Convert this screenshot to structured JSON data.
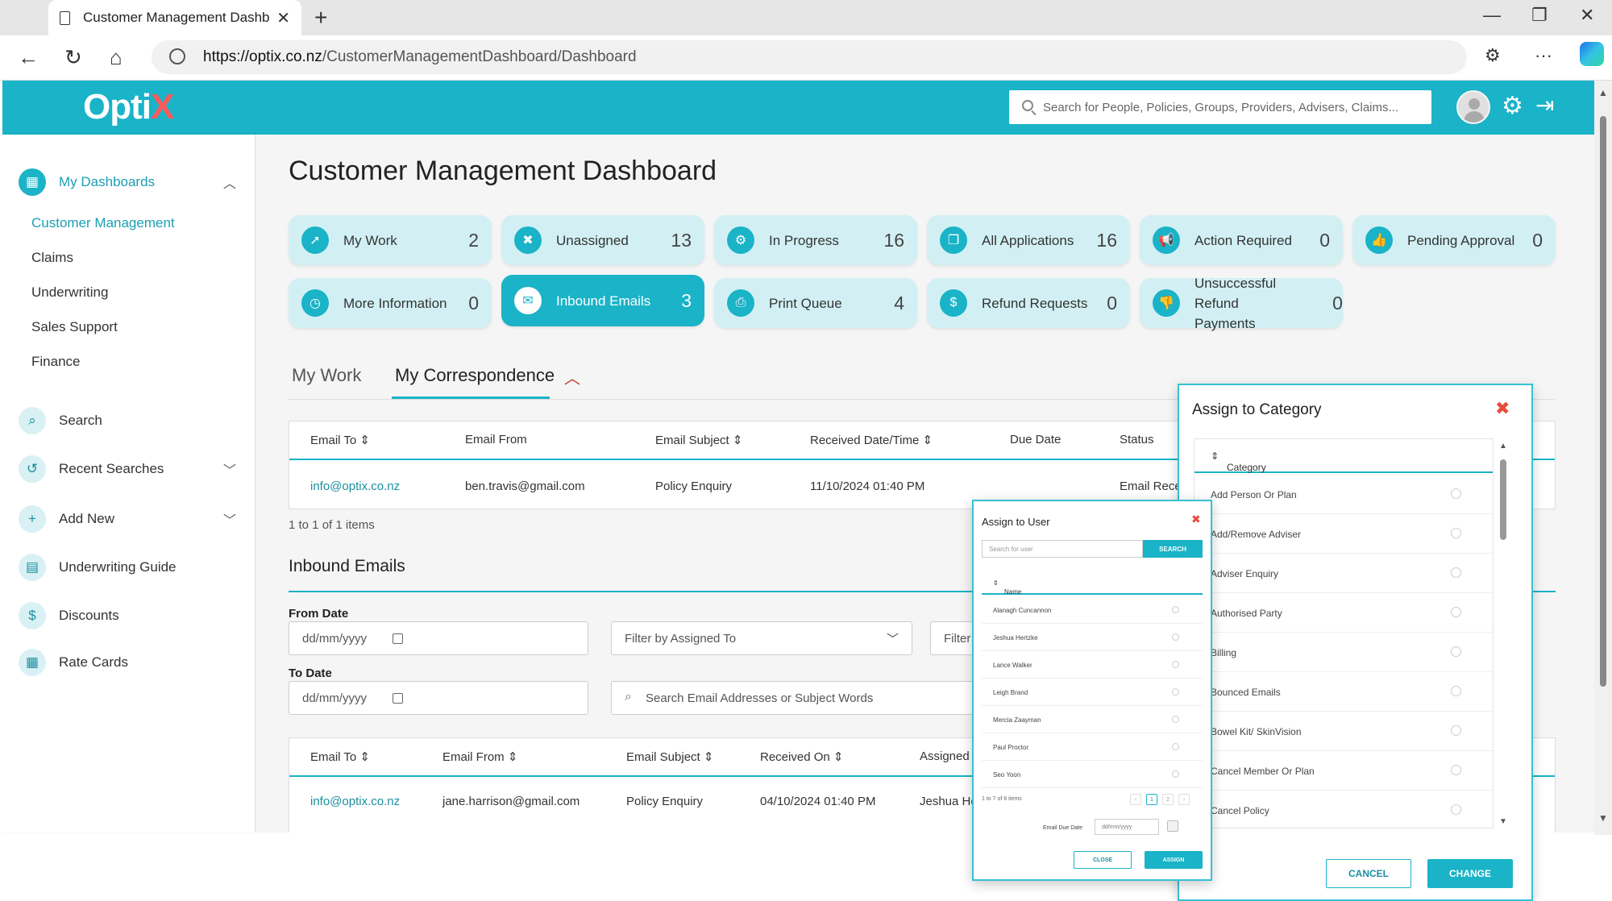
{
  "browser": {
    "tab_title": "Customer Management Dashboar",
    "url_host": "https://optix.co.nz",
    "url_path": "/CustomerManagementDashboard/Dashboard"
  },
  "header": {
    "logo_main": "Opti",
    "logo_accent": "X",
    "search_placeholder": "Search for People, Policies, Groups, Providers, Advisers, Claims..."
  },
  "sidebar": {
    "my_dashboards": "My Dashboards",
    "sub_items": [
      "Customer Management",
      "Claims",
      "Underwriting",
      "Sales Support",
      "Finance"
    ],
    "search": "Search",
    "recent_searches": "Recent Searches",
    "add_new": "Add New",
    "underwriting_guide": "Underwriting Guide",
    "discounts": "Discounts",
    "rate_cards": "Rate Cards"
  },
  "main": {
    "title": "Customer Management Dashboard",
    "cards": [
      {
        "label": "My Work",
        "count": "2"
      },
      {
        "label": "Unassigned",
        "count": "13"
      },
      {
        "label": "In Progress",
        "count": "16"
      },
      {
        "label": "All Applications",
        "count": "16"
      },
      {
        "label": "Action Required",
        "count": "0"
      },
      {
        "label": "Pending Approval",
        "count": "0"
      },
      {
        "label": "More Information",
        "count": "0"
      },
      {
        "label": "Inbound Emails",
        "count": "3"
      },
      {
        "label": "Print Queue",
        "count": "4"
      },
      {
        "label": "Refund Requests",
        "count": "0"
      },
      {
        "label": "Unsuccessful Refund Payments",
        "count": "0"
      }
    ],
    "tabs": [
      "My Work",
      "My Correspondence"
    ],
    "correspondence_table": {
      "headers": [
        "Email To",
        "Email From",
        "Email Subject",
        "Received Date/Time",
        "Due Date",
        "Status"
      ],
      "row": [
        "info@optix.co.nz",
        "ben.travis@gmail.com",
        "Policy Enquiry",
        "11/10/2024 01:40 PM",
        "",
        "Email Rece"
      ]
    },
    "items_count": "1 to 1 of 1 items",
    "inbound_title": "Inbound Emails",
    "from_date_label": "From Date",
    "to_date_label": "To Date",
    "date_placeholder": "dd/mm/yyyy",
    "filter_assigned": "Filter by Assigned To",
    "filter_other": "Filter",
    "search_emails_placeholder": "Search Email Addresses or Subject Words",
    "inbound_table": {
      "headers": [
        "Email To",
        "Email From",
        "Email Subject",
        "Received On",
        "Assigned"
      ],
      "row": [
        "info@optix.co.nz",
        "jane.harrison@gmail.com",
        "Policy Enquiry",
        "04/10/2024 01:40 PM",
        "Jeshua He"
      ]
    }
  },
  "category_modal": {
    "title": "Assign to Category",
    "column": "Category",
    "items": [
      "Add Person Or Plan",
      "Add/Remove Adviser",
      "Adviser Enquiry",
      "Authorised Party",
      "Billing",
      "Bounced Emails",
      "Bowel Kit/ SkinVision",
      "Cancel Member Or Plan",
      "Cancel Policy"
    ],
    "cancel": "CANCEL",
    "change": "CHANGE"
  },
  "user_modal": {
    "title": "Assign to User",
    "search_placeholder": "Search for user",
    "search_button": "SEARCH",
    "column": "Name",
    "users": [
      "Alanagh Cuncannon",
      "Jeshua Hertzke",
      "Lance Walker",
      "Leigh Brand",
      "Mercia Zaayman",
      "Paul Proctor",
      "Seo Yoon"
    ],
    "count": "1 to 7 of 8 items",
    "pages": [
      "1",
      "2"
    ],
    "due_label": "Email Due Date",
    "due_placeholder": "dd/mm/yyyy",
    "close": "CLOSE",
    "assign": "ASSIGN"
  }
}
